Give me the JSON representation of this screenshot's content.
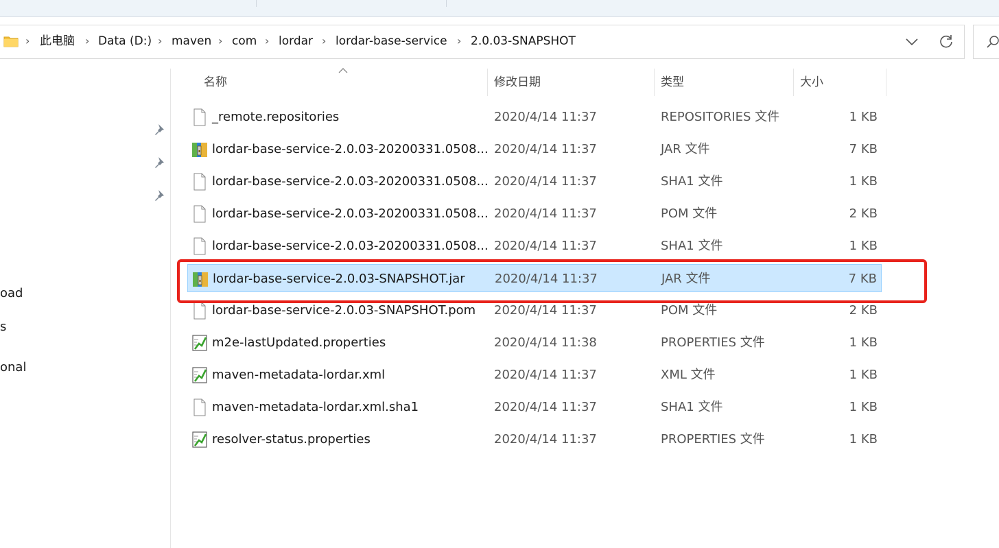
{
  "breadcrumb": [
    "此电脑",
    "Data (D:)",
    "maven",
    "com",
    "lordar",
    "lordar-base-service",
    "2.0.03-SNAPSHOT"
  ],
  "breadcrumb_separator": "›",
  "icons": {
    "folder": "folder-icon",
    "dropdown": "chevron-down-icon",
    "refresh": "refresh-icon",
    "search": "search-icon",
    "pin": "pin-icon",
    "file": "blank-file-icon",
    "jar": "winrar-archive-icon",
    "properties": "config-file-icon"
  },
  "columns": {
    "name": "名称",
    "date": "修改日期",
    "type": "类型",
    "size": "大小"
  },
  "nav_fragments": [
    "oad",
    "s",
    "onal"
  ],
  "files": [
    {
      "name": "_remote.repositories",
      "date": "2020/4/14 11:37",
      "type": "REPOSITORIES 文件",
      "size": "1 KB",
      "icon": "blank-file-icon"
    },
    {
      "name": "lordar-base-service-2.0.03-20200331.0508...",
      "date": "2020/4/14 11:37",
      "type": "JAR 文件",
      "size": "7 KB",
      "icon": "winrar-archive-icon"
    },
    {
      "name": "lordar-base-service-2.0.03-20200331.0508...",
      "date": "2020/4/14 11:37",
      "type": "SHA1 文件",
      "size": "1 KB",
      "icon": "blank-file-icon"
    },
    {
      "name": "lordar-base-service-2.0.03-20200331.0508...",
      "date": "2020/4/14 11:37",
      "type": "POM 文件",
      "size": "2 KB",
      "icon": "blank-file-icon"
    },
    {
      "name": "lordar-base-service-2.0.03-20200331.0508...",
      "date": "2020/4/14 11:37",
      "type": "SHA1 文件",
      "size": "1 KB",
      "icon": "blank-file-icon"
    },
    {
      "name": "lordar-base-service-2.0.03-SNAPSHOT.jar",
      "date": "2020/4/14 11:37",
      "type": "JAR 文件",
      "size": "7 KB",
      "icon": "winrar-archive-icon",
      "selected": true
    },
    {
      "name": "lordar-base-service-2.0.03-SNAPSHOT.pom",
      "date": "2020/4/14 11:37",
      "type": "POM 文件",
      "size": "2 KB",
      "icon": "blank-file-icon"
    },
    {
      "name": "m2e-lastUpdated.properties",
      "date": "2020/4/14 11:38",
      "type": "PROPERTIES 文件",
      "size": "1 KB",
      "icon": "config-file-icon"
    },
    {
      "name": "maven-metadata-lordar.xml",
      "date": "2020/4/14 11:37",
      "type": "XML 文件",
      "size": "1 KB",
      "icon": "config-file-icon"
    },
    {
      "name": "maven-metadata-lordar.xml.sha1",
      "date": "2020/4/14 11:37",
      "type": "SHA1 文件",
      "size": "1 KB",
      "icon": "blank-file-icon"
    },
    {
      "name": "resolver-status.properties",
      "date": "2020/4/14 11:37",
      "type": "PROPERTIES 文件",
      "size": "1 KB",
      "icon": "config-file-icon"
    }
  ],
  "colors": {
    "selection_bg": "#cce8ff",
    "selection_border": "#99d1ff",
    "highlight_box": "#e8221b"
  }
}
